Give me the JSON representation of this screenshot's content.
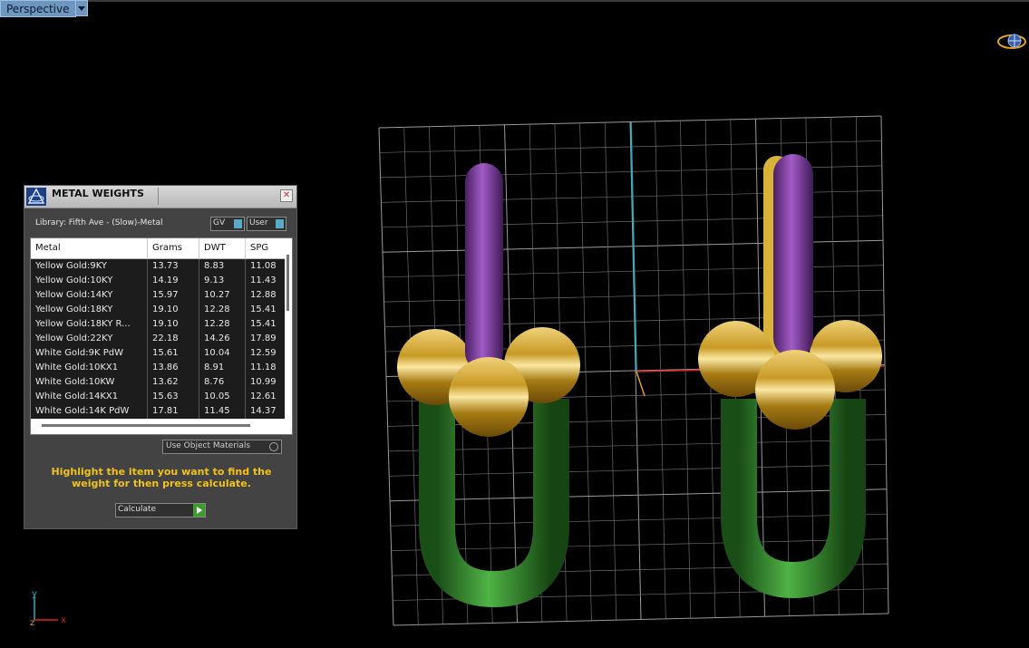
{
  "viewport": {
    "label": "Perspective"
  },
  "panel": {
    "title": "METAL WEIGHTS",
    "library": "Library: Fifth Ave - (Slow)-Metal",
    "toggles": [
      {
        "label": "GV"
      },
      {
        "label": "User"
      }
    ],
    "columns": [
      "Metal",
      "Grams",
      "DWT",
      "SPG"
    ],
    "rows": [
      [
        "Yellow Gold:9KY",
        "13.73",
        "8.83",
        "11.08"
      ],
      [
        "Yellow Gold:10KY",
        "14.19",
        "9.13",
        "11.43"
      ],
      [
        "Yellow Gold:14KY",
        "15.97",
        "10.27",
        "12.88"
      ],
      [
        "Yellow Gold:18KY",
        "19.10",
        "12.28",
        "15.41"
      ],
      [
        "Yellow Gold:18KY R...",
        "19.10",
        "12.28",
        "15.41"
      ],
      [
        "Yellow Gold:22KY",
        "22.18",
        "14.26",
        "17.89"
      ],
      [
        "White Gold:9K PdW",
        "15.61",
        "10.04",
        "12.59"
      ],
      [
        "White Gold:10KX1",
        "13.86",
        "8.91",
        "11.18"
      ],
      [
        "White Gold:10KW",
        "13.62",
        "8.76",
        "10.99"
      ],
      [
        "White Gold:14KX1",
        "15.63",
        "10.05",
        "12.61"
      ],
      [
        "White Gold:14K PdW",
        "17.81",
        "11.45",
        "14.37"
      ]
    ],
    "materials_dropdown": "Use Object Materials",
    "hint": "Highlight the item you want to find the weight for then press calculate.",
    "calculate_label": "Calculate"
  },
  "axes": {
    "y": "y",
    "z": "z",
    "x": "x"
  },
  "colors": {
    "accent_blue": "#6d97bf",
    "hint_yellow": "#f2c21a",
    "purple": "#7b3d9e",
    "green": "#2f8a2c",
    "gold": "#c79a24"
  }
}
